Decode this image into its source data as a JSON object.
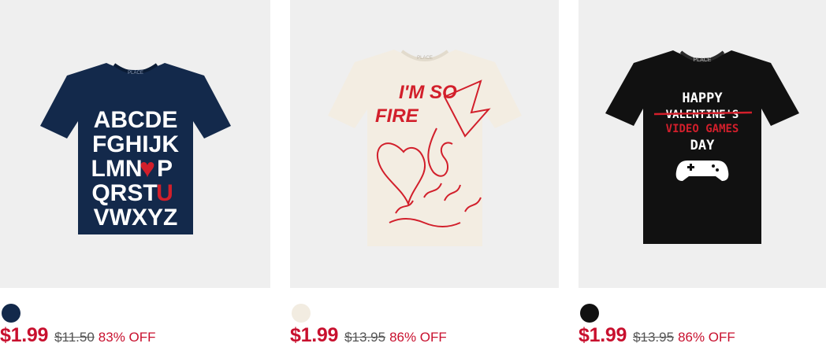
{
  "products": [
    {
      "image": {
        "shirt_color": "#13294b",
        "print_lines": [
          "ABCDE",
          "FGHIJK",
          "LMN",
          "P",
          "QRST",
          "U",
          "VWXYZ"
        ],
        "print_color": "#ffffff",
        "accent_color": "#d21f2b",
        "heart_glyph": "♥",
        "neck_label": "PLACE"
      },
      "swatch_color": "#13294b",
      "sale_price": "$1.99",
      "original_price": "$11.50",
      "discount": "83% OFF"
    },
    {
      "image": {
        "shirt_color": "#f3ede2",
        "print_lines": [
          "I'M SO",
          "FIRE"
        ],
        "print_color": "#d21f2b",
        "neck_label": "PLACE"
      },
      "swatch_color": "#f2ece1",
      "sale_price": "$1.99",
      "original_price": "$13.95",
      "discount": "86% OFF"
    },
    {
      "image": {
        "shirt_color": "#111111",
        "print_lines": [
          "HAPPY",
          "VALENTINE'S",
          "VIDEO GAMES",
          "DAY"
        ],
        "print_color": "#ffffff",
        "accent_color": "#d21f2b",
        "neck_label": "PLACE"
      },
      "swatch_color": "#111111",
      "sale_price": "$1.99",
      "original_price": "$13.95",
      "discount": "86% OFF"
    }
  ]
}
